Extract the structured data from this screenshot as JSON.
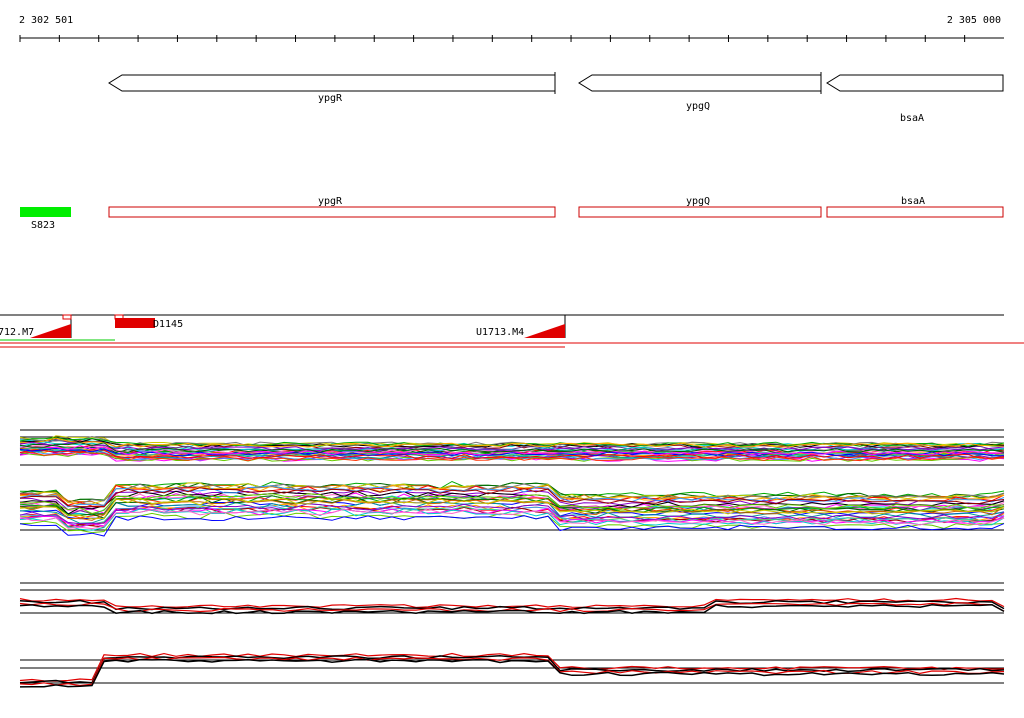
{
  "ruler": {
    "start_label": "2 302 501",
    "end_label": "2 305 000",
    "start": 2302501,
    "end": 2305000
  },
  "genes": [
    {
      "name": "ypgR",
      "strand": "-"
    },
    {
      "name": "ypgQ",
      "strand": "-"
    },
    {
      "name": "bsaA",
      "strand": "-"
    }
  ],
  "annotations": {
    "genes": [
      {
        "name": "ypgR"
      },
      {
        "name": "ypgQ"
      },
      {
        "name": "bsaA"
      }
    ],
    "s_segment": {
      "name": "S823",
      "color": "#00ee00"
    }
  },
  "transcripts": {
    "items": [
      {
        "name": "712.M7"
      },
      {
        "name": "D1145"
      },
      {
        "name": "U1713.M4"
      }
    ],
    "up_color": "#ff0000"
  },
  "colors": {
    "gene_outline": "#000000",
    "annotation_outline": "#cc0000",
    "track_red": "#e00000"
  }
}
